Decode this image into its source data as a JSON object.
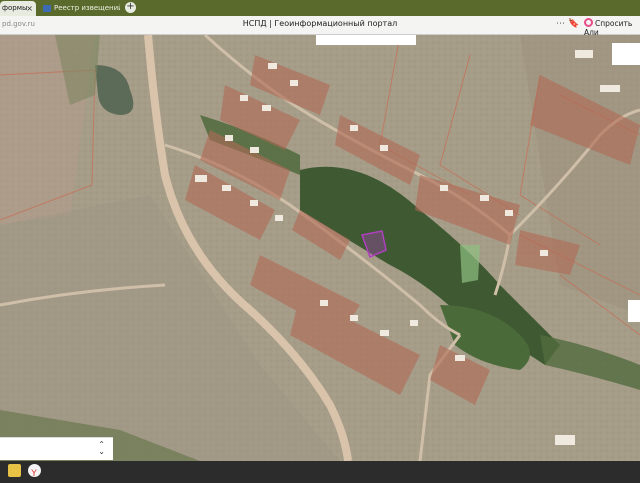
{
  "browser": {
    "tabs": [
      {
        "label": "формы",
        "active": true
      },
      {
        "label": "Реестр извещений",
        "active": false
      }
    ],
    "close_glyph": "×",
    "new_tab_glyph": "+",
    "url": "pd.gov.ru",
    "page_title": "НСПД | Геоинформационный портал",
    "ask_label": "Спросить Али",
    "icons": [
      "more-icon",
      "bookmark-icon",
      "alice-icon"
    ]
  },
  "map": {
    "selector_chevron": "⌃⌄",
    "colors": {
      "parcel_outline": "#c86b52",
      "highlight_outline": "#b03fc0",
      "road": "#dcc8b0"
    }
  },
  "taskbar": {
    "icons": [
      "file-explorer-icon",
      "yandex-browser-icon"
    ]
  }
}
